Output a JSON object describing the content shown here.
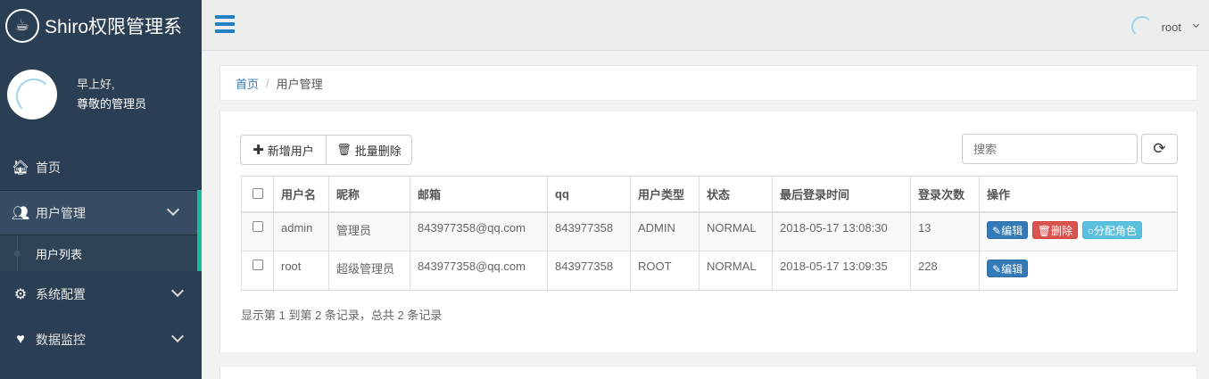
{
  "brand": {
    "title": "Shiro权限管理系",
    "logo_icon": "coffee-cup-icon"
  },
  "profile": {
    "greeting": "早上好,",
    "name": "尊敬的管理员"
  },
  "sidebar": {
    "items": [
      {
        "label": "首页",
        "icon": "home-icon"
      },
      {
        "label": "用户管理",
        "icon": "users-icon",
        "active": true
      },
      {
        "label": "用户列表"
      },
      {
        "label": "系统配置",
        "icon": "gears-icon"
      },
      {
        "label": "数据监控",
        "icon": "heartbeat-icon"
      }
    ]
  },
  "topbar": {
    "user": "root"
  },
  "breadcrumb": {
    "home": "首页",
    "current": "用户管理"
  },
  "toolbar": {
    "add_label": "新增用户",
    "batch_delete_label": "批量删除",
    "search_placeholder": "搜索"
  },
  "table": {
    "headers": [
      "用户名",
      "昵称",
      "邮箱",
      "qq",
      "用户类型",
      "状态",
      "最后登录时间",
      "登录次数",
      "操作"
    ],
    "rows": [
      {
        "username": "admin",
        "nickname": "管理员",
        "email": "843977358@qq.com",
        "qq": "843977358",
        "type": "ADMIN",
        "status": "NORMAL",
        "last_login": "2018-05-17 13:08:30",
        "count": "13"
      },
      {
        "username": "root",
        "nickname": "超级管理员",
        "email": "843977358@qq.com",
        "qq": "843977358",
        "type": "ROOT",
        "status": "NORMAL",
        "last_login": "2018-05-17 13:09:35",
        "count": "228"
      }
    ],
    "actions": {
      "edit": "编辑",
      "delete": "删除",
      "assign_role": "分配角色"
    }
  },
  "pagination": {
    "summary": "显示第 1 到第 2 条记录，总共 2 条记录"
  },
  "colors": {
    "sidebar_bg": "#2a3f54",
    "accent": "#1abb9c",
    "primary": "#337ab7",
    "danger": "#d9534f",
    "info": "#5bc0de"
  }
}
